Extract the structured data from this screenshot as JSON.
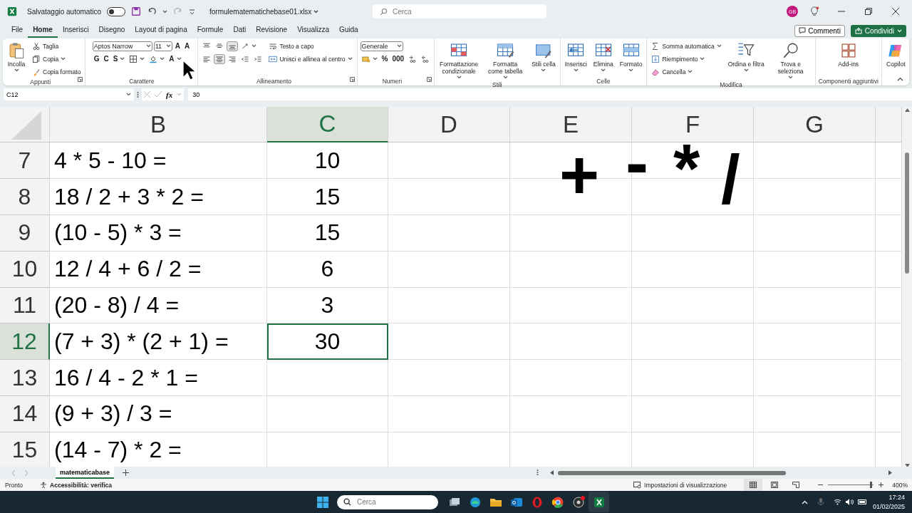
{
  "title_bar": {
    "autosave_label": "Salvataggio automatico",
    "autosave_on": false,
    "filename": "formulematematichebase01.xlsx",
    "search_placeholder": "Cerca",
    "avatar": "GB"
  },
  "menu_tabs": [
    {
      "label": "File",
      "selected": false
    },
    {
      "label": "Home",
      "selected": true
    },
    {
      "label": "Inserisci",
      "selected": false
    },
    {
      "label": "Disegno",
      "selected": false
    },
    {
      "label": "Layout di pagina",
      "selected": false
    },
    {
      "label": "Formule",
      "selected": false
    },
    {
      "label": "Dati",
      "selected": false
    },
    {
      "label": "Revisione",
      "selected": false
    },
    {
      "label": "Visualizza",
      "selected": false
    },
    {
      "label": "Guida",
      "selected": false
    }
  ],
  "comments_button": "Commenti",
  "share_button": "Condividi",
  "ribbon": {
    "groups": [
      {
        "label": "Appunti",
        "launcher": true,
        "columns": [
          [
            [
              {
                "kind": "large",
                "label": "Incolla",
                "menu": true
              }
            ]
          ],
          [
            [
              {
                "kind": "small",
                "label": "Taglia"
              }
            ],
            [
              {
                "kind": "small",
                "label": "Copia",
                "menu": true
              }
            ],
            [
              {
                "kind": "small",
                "label": "Copia formato"
              }
            ]
          ]
        ]
      },
      {
        "label": "Carattere",
        "columns": [
          [
            [
              {
                "kind": "dropdown",
                "value": "Aptos Narrow"
              },
              {
                "kind": "dropdown",
                "value": "11"
              },
              {
                "kind": "glyph",
                "label": "A"
              },
              {
                "kind": "glyph",
                "label": "A"
              }
            ],
            [
              {
                "kind": "glyph",
                "label": "G"
              },
              {
                "kind": "glyph",
                "label": "C"
              },
              {
                "kind": "glyph",
                "label": "S",
                "menu": true
              },
              {
                "kind": "icon",
                "menu": true
              },
              {
                "kind": "icon",
                "menu": true
              },
              {
                "kind": "glyph",
                "label": "A",
                "menu": true
              }
            ]
          ]
        ]
      },
      {
        "label": "Allineamento",
        "launcher": true,
        "columns": [
          [
            [
              {
                "kind": "icon",
                "on": false
              },
              {
                "kind": "icon",
                "on": false
              },
              {
                "kind": "icon",
                "on": true
              },
              {
                "kind": "icon",
                "on": false,
                "menu": true
              }
            ],
            [
              {
                "kind": "icon",
                "on": false
              },
              {
                "kind": "icon",
                "on": true
              },
              {
                "kind": "icon",
                "on": false
              },
              {
                "kind": "icon",
                "on": false
              },
              {
                "kind": "icon",
                "on": false
              }
            ]
          ],
          [
            [
              {
                "kind": "small",
                "label": "Testo a capo"
              }
            ],
            [
              {
                "kind": "small",
                "label": "Unisci e allinea al centro",
                "menu": true
              }
            ]
          ]
        ]
      },
      {
        "label": "Numeri",
        "launcher": true,
        "columns": [
          [
            [
              {
                "kind": "dropdown",
                "value": "Generale"
              }
            ],
            [
              {
                "kind": "icon",
                "menu": true
              },
              {
                "kind": "glyph",
                "label": "%"
              },
              {
                "kind": "glyph",
                "label": "000"
              },
              {
                "kind": "icon"
              },
              {
                "kind": "icon"
              }
            ]
          ]
        ]
      },
      {
        "label": "Stili",
        "columns": [
          [
            [
              {
                "kind": "large",
                "label": "Formattazione condizionale",
                "menu": true
              }
            ]
          ],
          [
            [
              {
                "kind": "large",
                "label": "Formatta come tabella",
                "menu": true
              }
            ]
          ],
          [
            [
              {
                "kind": "large",
                "label": "Stili cella",
                "menu": true
              }
            ]
          ]
        ]
      },
      {
        "label": "Celle",
        "columns": [
          [
            [
              {
                "kind": "large",
                "label": "Inserisci",
                "menu": true
              }
            ]
          ],
          [
            [
              {
                "kind": "large",
                "label": "Elimina",
                "menu": true
              }
            ]
          ],
          [
            [
              {
                "kind": "large",
                "label": "Formato",
                "menu": true
              }
            ]
          ]
        ]
      },
      {
        "label": "Modifica",
        "columns": [
          [
            [
              {
                "kind": "small",
                "label": "Somma automatica",
                "menu": true
              }
            ],
            [
              {
                "kind": "small",
                "label": "Riempimento",
                "menu": true
              }
            ],
            [
              {
                "kind": "small",
                "label": "Cancella",
                "menu": true
              }
            ]
          ],
          [
            [
              {
                "kind": "large",
                "label": "Ordina e filtra",
                "menu": true
              }
            ]
          ],
          [
            [
              {
                "kind": "large",
                "label": "Trova e seleziona",
                "menu": true
              }
            ]
          ]
        ]
      },
      {
        "label": "Componenti aggiuntivi",
        "columns": [
          [
            [
              {
                "kind": "large",
                "label": "Add-ins"
              }
            ]
          ]
        ]
      },
      {
        "columns": [
          [
            [
              {
                "kind": "large",
                "label": "Copilot"
              }
            ]
          ]
        ]
      }
    ]
  },
  "formula_bar": {
    "name_box": "C12",
    "function_label": "fx",
    "formula": "30"
  },
  "sheet": {
    "columns": [
      {
        "label": "B",
        "selected": false
      },
      {
        "label": "C",
        "selected": true
      },
      {
        "label": "D",
        "selected": false
      },
      {
        "label": "E",
        "selected": false
      },
      {
        "label": "F",
        "selected": false
      },
      {
        "label": "G",
        "selected": false
      }
    ],
    "rows": [
      {
        "number": "7",
        "selected": false,
        "cells": [
          {
            "text": "4 * 5 - 10 =",
            "active": false
          },
          {
            "text": "10",
            "active": false
          }
        ]
      },
      {
        "number": "8",
        "selected": false,
        "cells": [
          {
            "text": "18 / 2 + 3 * 2 =",
            "active": false
          },
          {
            "text": "15",
            "active": false
          }
        ]
      },
      {
        "number": "9",
        "selected": false,
        "cells": [
          {
            "text": "(10 - 5) * 3 =",
            "active": false
          },
          {
            "text": "15",
            "active": false
          }
        ]
      },
      {
        "number": "10",
        "selected": false,
        "cells": [
          {
            "text": "12 / 4 + 6 / 2 =",
            "active": false
          },
          {
            "text": "6",
            "active": false
          }
        ]
      },
      {
        "number": "11",
        "selected": false,
        "cells": [
          {
            "text": "(20 - 8) / 4 =",
            "active": false
          },
          {
            "text": "3",
            "active": false
          }
        ]
      },
      {
        "number": "12",
        "selected": true,
        "cells": [
          {
            "text": "(7 + 3) * (2 + 1) =",
            "active": false
          },
          {
            "text": "30",
            "active": true
          }
        ]
      },
      {
        "number": "13",
        "selected": false,
        "cells": [
          {
            "text": "16 / 4 - 2 * 1 =",
            "active": false
          }
        ]
      },
      {
        "number": "14",
        "selected": false,
        "cells": [
          {
            "text": "(9 + 3) / 3 =",
            "active": false
          }
        ]
      },
      {
        "number": "15",
        "selected": false,
        "cells": [
          {
            "text": "(14 - 7) * 2 =",
            "active": false
          }
        ]
      }
    ],
    "symbols": [
      "+",
      "-",
      "*",
      "/"
    ]
  },
  "sheet_tabs": [
    {
      "label": "matematicabase",
      "selected": true
    }
  ],
  "status_bar": {
    "status": "Pronto",
    "accessibility": "Accessibilità: verifica",
    "display_settings": "Impostazioni di visualizzazione",
    "zoom_slider": {
      "level": 0.93
    },
    "zoom": "400%"
  },
  "taskbar": {
    "search_placeholder": "Cerca",
    "time": "17:24",
    "date": "01/02/2025"
  }
}
